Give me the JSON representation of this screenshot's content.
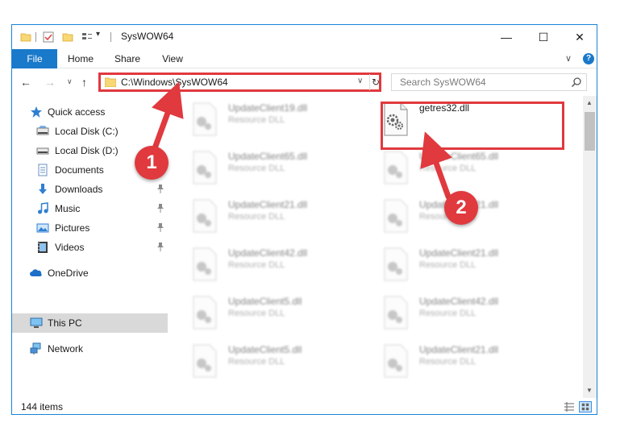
{
  "window": {
    "title": "SysWOW64",
    "quick_access_dropdown": "▾"
  },
  "title_buttons": {
    "minimize": "—",
    "maximize": "☐",
    "close": "✕"
  },
  "ribbon": {
    "tabs": [
      {
        "label": "File",
        "active": true
      },
      {
        "label": "Home"
      },
      {
        "label": "Share"
      },
      {
        "label": "View"
      }
    ],
    "collapse_glyph": "∨",
    "help_glyph": "?"
  },
  "nav": {
    "back_glyph": "←",
    "forward_glyph": "→",
    "recent_glyph": "∨",
    "up_glyph": "↑",
    "address": "C:\\Windows\\SysWOW64",
    "address_dropdown": "∨",
    "refresh_glyph": "↻",
    "search_placeholder": "Search SysWOW64"
  },
  "sidebar": {
    "items": [
      {
        "label": "Quick access",
        "icon": "star-icon",
        "pinned": false
      },
      {
        "label": "Local Disk (C:)",
        "icon": "drive-icon",
        "pinned": false
      },
      {
        "label": "Local Disk (D:)",
        "icon": "drive-icon",
        "pinned": false
      },
      {
        "label": "Documents",
        "icon": "documents-icon",
        "pinned": false
      },
      {
        "label": "Downloads",
        "icon": "downloads-icon",
        "pinned": true
      },
      {
        "label": "Music",
        "icon": "music-icon",
        "pinned": true
      },
      {
        "label": "Pictures",
        "icon": "pictures-icon",
        "pinned": true
      },
      {
        "label": "Videos",
        "icon": "videos-icon",
        "pinned": true
      },
      {
        "label": "OneDrive",
        "icon": "onedrive-icon",
        "pinned": false
      },
      {
        "label": "This PC",
        "icon": "pc-icon",
        "selected": true
      },
      {
        "label": "Network",
        "icon": "network-icon",
        "pinned": false
      }
    ]
  },
  "files": {
    "left_column": [
      {
        "name": "UpdateClient19.dll",
        "type": "Resource DLL"
      },
      {
        "name": "UpdateClient65.dll",
        "type": "Resource DLL"
      },
      {
        "name": "UpdateClient21.dll",
        "type": "Resource DLL"
      },
      {
        "name": "UpdateClient42.dll",
        "type": "Resource DLL"
      },
      {
        "name": "UpdateClient5.dll",
        "type": "Resource DLL"
      },
      {
        "name": "UpdateClient5.dll",
        "type": "Resource DLL"
      }
    ],
    "right_column": [
      {
        "name": "getres32.dll",
        "type": "",
        "highlighted": true
      },
      {
        "name": "UpdateClient65.dll",
        "type": "Resource DLL"
      },
      {
        "name": "UpdateClient21.dll",
        "type": "Resource DLL"
      },
      {
        "name": "UpdateClient21.dll",
        "type": "Resource DLL"
      },
      {
        "name": "UpdateClient42.dll",
        "type": "Resource DLL"
      },
      {
        "name": "UpdateClient21.dll",
        "type": "Resource DLL"
      }
    ]
  },
  "status": {
    "item_count": "144 items"
  },
  "annotations": {
    "callout_1": "1",
    "callout_2": "2",
    "color": "#e0393e"
  },
  "colors": {
    "accent": "#1979ca",
    "selection": "#d9d9d9",
    "highlight": "#e0393e"
  }
}
